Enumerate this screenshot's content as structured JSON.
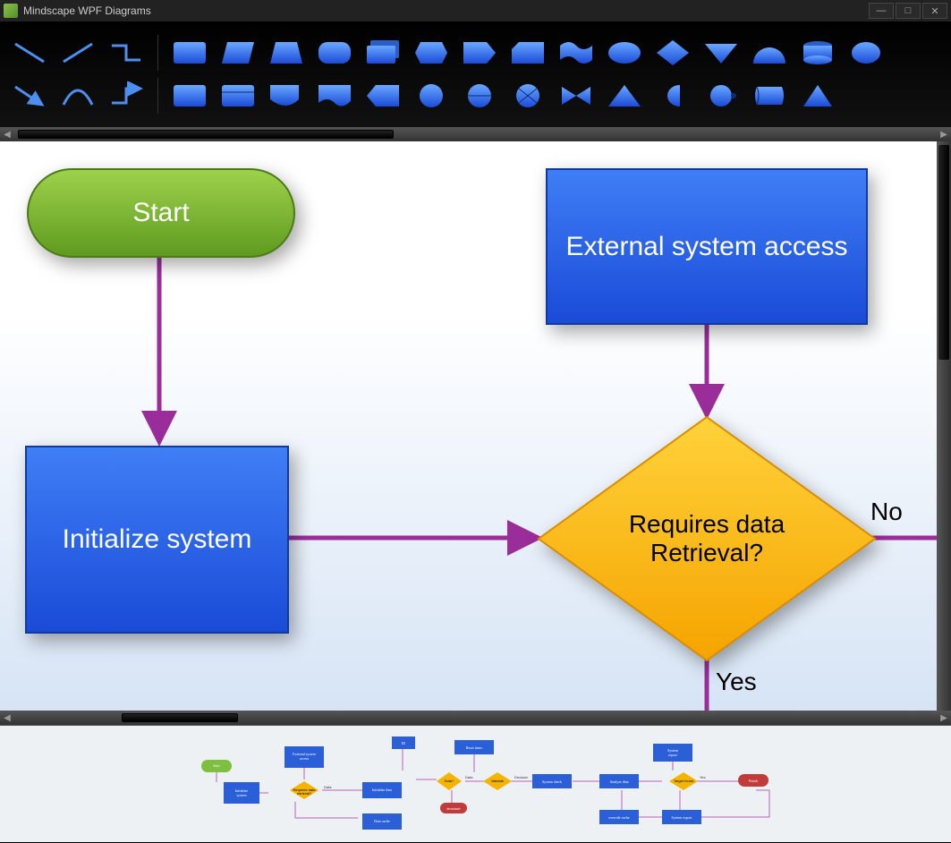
{
  "app": {
    "title": "Mindscape WPF Diagrams"
  },
  "flow": {
    "nodes": {
      "start": "Start",
      "init": "Initialize system",
      "ext": "External system access",
      "decision": "Requires data Retrieval?"
    },
    "edge_labels": {
      "yes": "Yes",
      "no": "No"
    }
  },
  "overview": {
    "nodes": [
      {
        "id": "start",
        "label": "Start",
        "type": "terminator",
        "color": "green"
      },
      {
        "id": "init",
        "label": "Initialize system",
        "type": "process",
        "color": "blue"
      },
      {
        "id": "ext",
        "label": "External system access",
        "type": "process",
        "color": "blue"
      },
      {
        "id": "reqdata",
        "label": "Requires data retrieval?",
        "type": "decision",
        "color": "yellow"
      },
      {
        "id": "initdata",
        "label": "Initialize data",
        "type": "process",
        "color": "blue"
      },
      {
        "id": "cache",
        "label": "Data cache",
        "type": "process",
        "color": "blue"
      },
      {
        "id": "id",
        "label": "ID",
        "type": "process",
        "color": "blue"
      },
      {
        "id": "reset",
        "label": "Reset timer",
        "type": "process",
        "color": "blue"
      },
      {
        "id": "dataq",
        "label": "Data?",
        "type": "decision",
        "color": "yellow"
      },
      {
        "id": "validate",
        "label": "Validate",
        "type": "decision",
        "color": "yellow"
      },
      {
        "id": "term",
        "label": "terminate",
        "type": "terminator",
        "color": "red"
      },
      {
        "id": "syscheck",
        "label": "System check",
        "type": "process",
        "color": "blue"
      },
      {
        "id": "analyze",
        "label": "Analyze data",
        "type": "process",
        "color": "blue"
      },
      {
        "id": "override",
        "label": "override cache",
        "type": "process",
        "color": "blue"
      },
      {
        "id": "sysexp",
        "label": "System export",
        "type": "process",
        "color": "blue"
      },
      {
        "id": "sysrep",
        "label": "System report",
        "type": "process",
        "color": "blue"
      },
      {
        "id": "target",
        "label": "Target found",
        "type": "decision",
        "color": "yellow"
      },
      {
        "id": "finish",
        "label": "Finish",
        "type": "terminator",
        "color": "red"
      }
    ],
    "edges": [
      [
        "start",
        "init"
      ],
      [
        "ext",
        "reqdata"
      ],
      [
        "init",
        "reqdata"
      ],
      [
        "reqdata",
        "initdata",
        "Data"
      ],
      [
        "reqdata",
        "cache"
      ],
      [
        "initdata",
        "dataq"
      ],
      [
        "cache",
        "dataq"
      ],
      [
        "id",
        "dataq"
      ],
      [
        "reset",
        "validate"
      ],
      [
        "dataq",
        "validate",
        "Data"
      ],
      [
        "validate",
        "syscheck",
        "Decision"
      ],
      [
        "validate",
        "term"
      ],
      [
        "syscheck",
        "analyze"
      ],
      [
        "analyze",
        "target"
      ],
      [
        "sysrep",
        "target"
      ],
      [
        "target",
        "finish",
        "Yes"
      ],
      [
        "target",
        "override"
      ],
      [
        "override",
        "sysexp"
      ],
      [
        "sysexp",
        "sysrep"
      ]
    ]
  },
  "colors": {
    "connector": "#9b2d9b",
    "blue_top": "#3f7ef5",
    "blue_bot": "#1a4bd8",
    "green_top": "#9dd14b",
    "green_bot": "#5f9b1f",
    "yellow_top": "#ffd23a",
    "yellow_bot": "#f5a400"
  }
}
